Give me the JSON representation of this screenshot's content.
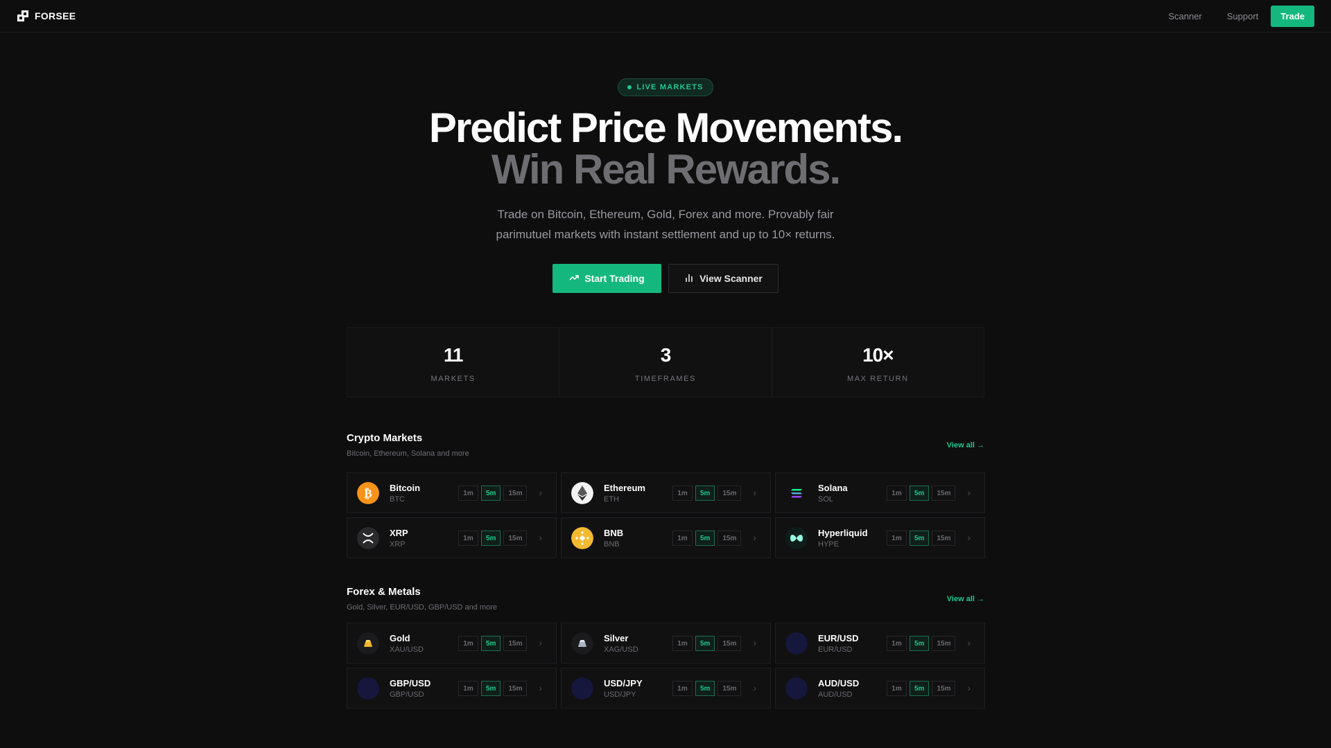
{
  "nav": {
    "brand": "FORSEE",
    "links": [
      "Scanner",
      "Support"
    ],
    "trade_label": "Trade"
  },
  "hero": {
    "badge": "LIVE MARKETS",
    "headline_line1": "Predict Price Movements.",
    "headline_line2": "Win Real Rewards.",
    "subtitle": "Trade on Bitcoin, Ethereum, Gold, Forex and more. Provably fair parimutuel markets with instant settlement and up to 10× returns.",
    "primary_cta": "Start Trading",
    "secondary_cta": "View Scanner"
  },
  "stats": [
    {
      "value": "11",
      "label": "MARKETS"
    },
    {
      "value": "3",
      "label": "TIMEFRAMES"
    },
    {
      "value": "10×",
      "label": "MAX RETURN"
    }
  ],
  "timeframes": [
    "1m",
    "5m",
    "15m"
  ],
  "active_timeframe": "5m",
  "colors": {
    "accent": "#14b87e",
    "background": "#0e0e0f"
  },
  "crypto": {
    "title": "Crypto Markets",
    "subtitle": "Bitcoin, Ethereum, Solana and more",
    "view_all": "View all →",
    "markets": [
      {
        "name": "Bitcoin",
        "ticker": "BTC",
        "icon": "bitcoin-icon"
      },
      {
        "name": "Ethereum",
        "ticker": "ETH",
        "icon": "ethereum-icon"
      },
      {
        "name": "Solana",
        "ticker": "SOL",
        "icon": "solana-icon"
      },
      {
        "name": "XRP",
        "ticker": "XRP",
        "icon": "xrp-icon"
      },
      {
        "name": "BNB",
        "ticker": "BNB",
        "icon": "bnb-icon"
      },
      {
        "name": "Hyperliquid",
        "ticker": "HYPE",
        "icon": "hyperliquid-icon"
      }
    ]
  },
  "forex": {
    "title": "Forex & Metals",
    "subtitle": "Gold, Silver, EUR/USD, GBP/USD and more",
    "view_all": "View all →",
    "markets": [
      {
        "name": "Gold",
        "ticker": "XAU/USD",
        "icon": "gold-bar-icon"
      },
      {
        "name": "Silver",
        "ticker": "XAG/USD",
        "icon": "silver-bar-icon"
      },
      {
        "name": "EUR/USD",
        "ticker": "EUR/USD",
        "icon": "eur-flag-icon"
      },
      {
        "name": "GBP/USD",
        "ticker": "GBP/USD",
        "icon": "gbp-flag-icon"
      },
      {
        "name": "USD/JPY",
        "ticker": "USD/JPY",
        "icon": "jpy-flag-icon"
      },
      {
        "name": "AUD/USD",
        "ticker": "AUD/USD",
        "icon": "aud-flag-icon"
      }
    ]
  }
}
